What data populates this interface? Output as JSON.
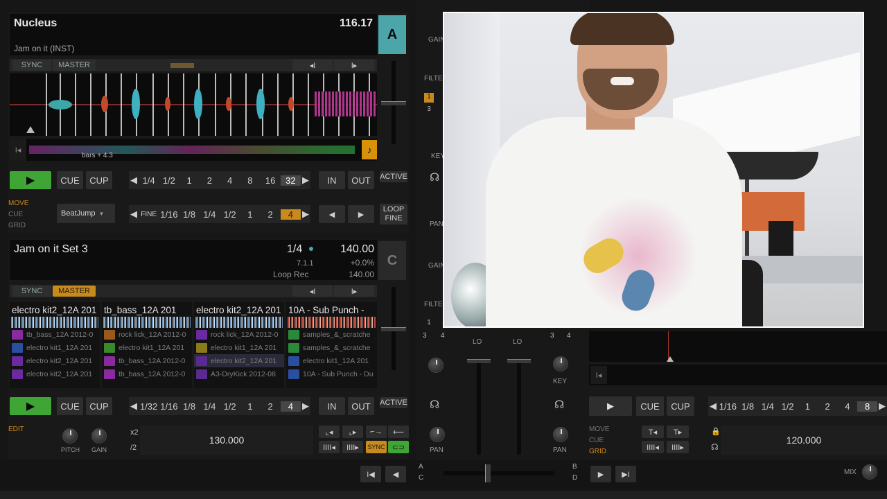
{
  "deck_a": {
    "title": "Nucleus",
    "bpm": "116.17",
    "letter": "A",
    "artist": "Jam on it (INST)",
    "sync": "SYNC",
    "master": "MASTER",
    "prev_icon": "◂I",
    "next_icon": "I▸",
    "position_label": "bars + 4.3",
    "play": "▶",
    "cue": "CUE",
    "cup": "CUP",
    "loop_sizes": [
      "1/4",
      "1/2",
      "1",
      "2",
      "4",
      "8",
      "16",
      "32"
    ],
    "in": "IN",
    "out": "OUT",
    "active": "ACTIVE",
    "mode_labels": [
      "MOVE",
      "CUE",
      "GRID"
    ],
    "beatjump": "BeatJump",
    "move_sizes": [
      "FINE",
      "1/16",
      "1/8",
      "1/4",
      "1/2",
      "1",
      "2",
      "4"
    ],
    "loop_fine_1": "LOOP",
    "loop_fine_2": "FINE"
  },
  "deck_c": {
    "title": "Jam on it  Set 3",
    "fraction": "1/4",
    "bpm": "140.00",
    "letter": "C",
    "key": "7.1.1",
    "pitch": "+0.0%",
    "mode": "Loop Rec",
    "bpm2": "140.00",
    "sync": "SYNC",
    "master": "MASTER",
    "slots": [
      {
        "title": "electro kit2_12A 201",
        "color": "#8fb2d4",
        "rows": [
          {
            "name": "tb_bass_12A 2012-0",
            "color": "#8a2aa0"
          },
          {
            "name": "electro kit1_12A 201",
            "color": "#2a4fa0"
          },
          {
            "name": "electro kit2_12A 201",
            "color": "#6a2aa0"
          },
          {
            "name": "electro kit2_12A 201",
            "color": "#6a2aa0"
          }
        ]
      },
      {
        "title": "tb_bass_12A 201",
        "color": "#b5c7d8",
        "rows": [
          {
            "name": "rock lick_12A 2012-0",
            "color": "#9a5a1a"
          },
          {
            "name": "electro kit1_12A 201",
            "color": "#3a8a2a"
          },
          {
            "name": "tb_bass_12A 2012-0",
            "color": "#8a2aa0"
          },
          {
            "name": "tb_bass_12A 2012-0",
            "color": "#8a2aa0"
          }
        ]
      },
      {
        "title": "electro kit2_12A 201",
        "color": "#8fb2d4",
        "rows": [
          {
            "name": "rock lick_12A 2012-0",
            "color": "#6a2aa0"
          },
          {
            "name": "electro kit1_12A 201",
            "color": "#8a7a1a"
          },
          {
            "name": "electro kit2_12A 201",
            "color": "#5a2a90"
          },
          {
            "name": "A3-DryKick 2012-08",
            "color": "#5a2a90"
          }
        ]
      },
      {
        "title": "10A - Sub Punch - ",
        "color": "#b84a3a",
        "rows": [
          {
            "name": "samples_&_scratche",
            "color": "#2a8a3a"
          },
          {
            "name": "samples_&_scratche",
            "color": "#2a8a3a"
          },
          {
            "name": "electro kit1_12A 201",
            "color": "#2a4fa0"
          },
          {
            "name": "10A - Sub Punch - Du",
            "color": "#2a4fa0"
          }
        ]
      }
    ],
    "play": "▶",
    "cue": "CUE",
    "cup": "CUP",
    "loop_sizes": [
      "1/32",
      "1/16",
      "1/8",
      "1/4",
      "1/2",
      "1",
      "2",
      "4"
    ],
    "in": "IN",
    "out": "OUT",
    "active": "ACTIVE",
    "edit": "EDIT",
    "x2": "x2",
    "d2": "/2",
    "tempo": "130.000",
    "pitch_label": "PITCH",
    "gain_label": "GAIN",
    "sync_btn": "SYNC"
  },
  "mixer": {
    "gain": "GAIN",
    "filter": "FILTE",
    "key": "KEY",
    "pan": "PAN",
    "lo": "LO",
    "n1": "1",
    "n3": "3",
    "n4": "4"
  },
  "deck_d": {
    "play": "▶",
    "cue": "CUE",
    "cup": "CUP",
    "loop_sizes": [
      "1/16",
      "1/8",
      "1/4",
      "1/2",
      "1",
      "2",
      "4",
      "8"
    ],
    "mode_labels": [
      "MOVE",
      "CUE",
      "GRID"
    ],
    "tempo": "120.000",
    "letter_a": "A",
    "letter_b": "B",
    "letter_c": "C",
    "letter_d": "D",
    "mix": "MIX"
  },
  "video": {
    "description_alt": "webcam"
  }
}
